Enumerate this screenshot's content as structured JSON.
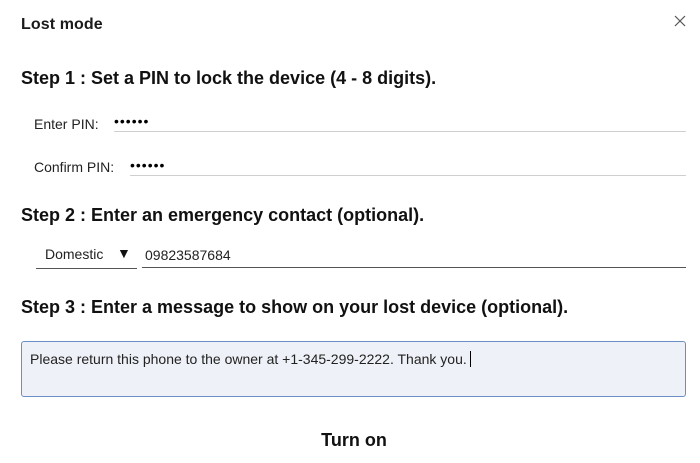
{
  "dialog": {
    "title": "Lost mode",
    "close_icon": "close-icon"
  },
  "step1": {
    "heading": "Step 1 : Set a PIN to lock the device (4 - 8 digits).",
    "enter_pin_label": "Enter PIN:",
    "enter_pin_value": "••••••",
    "confirm_pin_label": "Confirm PIN:",
    "confirm_pin_value": "••••••"
  },
  "step2": {
    "heading": "Step 2 : Enter an emergency contact (optional).",
    "region_selected": "Domestic",
    "region_arrow": "▼",
    "phone_value": "09823587684"
  },
  "step3": {
    "heading": "Step 3 : Enter a message to show on your lost device (optional).",
    "message_value": "Please return this phone to the owner at +1-345-299-2222. Thank you."
  },
  "actions": {
    "turn_on_label": "Turn on"
  },
  "colors": {
    "message_border": "#6b8fc5",
    "message_background": "#eef1f7"
  }
}
